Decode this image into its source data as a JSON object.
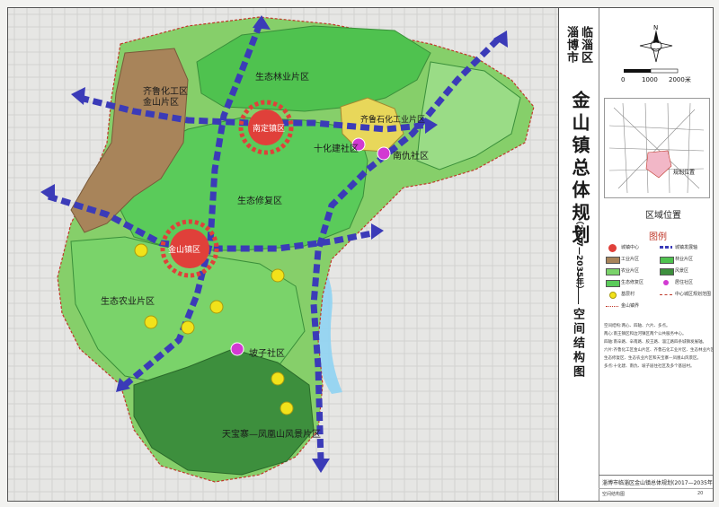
{
  "map": {
    "zones": [
      {
        "id": "industrial",
        "label": "齐鲁化工区\n金山片区"
      },
      {
        "id": "forestry",
        "label": "生态林业片区"
      },
      {
        "id": "restoration",
        "label": "生态修复区"
      },
      {
        "id": "agriculture",
        "label": "生态农业片区"
      },
      {
        "id": "scenic",
        "label": "天宝寨—凤凰山风景片区"
      },
      {
        "id": "petro",
        "label": "齐鲁石化工业片区"
      }
    ],
    "centers": [
      {
        "id": "south",
        "label": "南定镇区"
      },
      {
        "id": "main",
        "label": "金山镇区"
      }
    ],
    "communities": [
      {
        "id": "shihua",
        "label": "十化建社区"
      },
      {
        "id": "nanyang",
        "label": "南仇社区"
      },
      {
        "id": "pozi",
        "label": "坡子社区"
      }
    ]
  },
  "panel": {
    "city": "淄博市",
    "district": "临淄区",
    "plan_title": "金山镇总体规划",
    "plan_years": "（2017—2035年）",
    "sheet_name": "空间结构图",
    "compass_letter": "N",
    "scale": {
      "labels": [
        "0",
        "1000",
        "2000米"
      ]
    },
    "inset": {
      "label": "规划位置"
    },
    "inset_caption": "区域位置",
    "legend_title": "图例",
    "legend": [
      {
        "label": "城镇中心",
        "icon": "town-center"
      },
      {
        "label": "城镇发展轴",
        "icon": "development-axis"
      },
      {
        "label": "工业片区",
        "icon": "industrial-zone",
        "color": "#a8845a"
      },
      {
        "label": "林业片区",
        "icon": "forestry-zone",
        "color": "#4fc24f"
      },
      {
        "label": "农业片区",
        "icon": "agriculture-zone",
        "color": "#7ad36a"
      },
      {
        "label": "风景区",
        "icon": "scenic-zone",
        "color": "#3d8f3d"
      },
      {
        "label": "生态修复区",
        "icon": "restoration-zone",
        "color": "#5acb5a"
      },
      {
        "label": "居住社区",
        "icon": "community"
      },
      {
        "label": "基层村",
        "icon": "village"
      },
      {
        "label": "中心城区规划范围",
        "icon": "boundary"
      },
      {
        "label": "金山镇界",
        "icon": "town-boundary"
      }
    ],
    "notes": [
      "空间结构:两心、四轴、六片、多点。",
      "两心:南王镇区和边河镇区两个公共服务中心。",
      "四轴:南辛路、辛南路、胶王路、淄江路四条城镇发展轴。",
      "六片:齐鲁化工区金山片区、齐鲁石化工业片区、生态林业片区、",
      "生态修复区、生态农业片区和天宝寨—凤凰山风景区。",
      "多点:十化建、南仇、坡子居住社区及多个基层村。"
    ],
    "footer": {
      "title": "淄博市临淄区金山镇总体规划(2017—2035年)",
      "sheet": "空间结构图",
      "page": "20"
    }
  }
}
